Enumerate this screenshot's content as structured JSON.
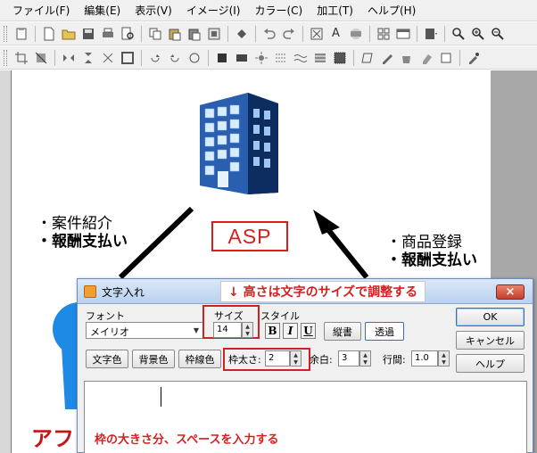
{
  "menu": [
    "ファイル(F)",
    "編集(E)",
    "表示(V)",
    "イメージ(I)",
    "カラー(C)",
    "加工(T)",
    "ヘルプ(H)"
  ],
  "canvas": {
    "badge_label": "ASP",
    "note_left": {
      "line1": "・案件紹介",
      "line2": "・報酬支払い"
    },
    "note_right": {
      "line1": "・商品登録",
      "line2": "・報酬支払い"
    },
    "partial_bottom_text": "アフ"
  },
  "dialog": {
    "title": "文字入れ",
    "close_label": "×",
    "font_label": "フォント",
    "font_value": "メイリオ",
    "size_label": "サイズ",
    "size_value": "14",
    "style_label": "スタイル",
    "bold_label": "B",
    "italic_label": "I",
    "underline_label": "U",
    "vertical_label": "縦書",
    "transparent_label": "透過",
    "text_color_label": "文字色",
    "bg_color_label": "背景色",
    "border_color_label": "枠線色",
    "frame_label": "枠太さ:",
    "frame_value": "2",
    "margin_label": "余白:",
    "margin_value": "3",
    "linespace_label": "行間:",
    "linespace_value": "1.0",
    "ok_label": "OK",
    "cancel_label": "キャンセル",
    "help_label": "ヘルプ"
  },
  "annotations": {
    "top": "↓ 高さは文字のサイズで調整する",
    "bottom": "枠の大きさ分、スペースを入力する"
  },
  "colors": {
    "accent_red": "#d42020",
    "building_blue": "#1f4f9a",
    "person_blue": "#1e8ae6",
    "dialog_title": "#b9d1ef"
  }
}
